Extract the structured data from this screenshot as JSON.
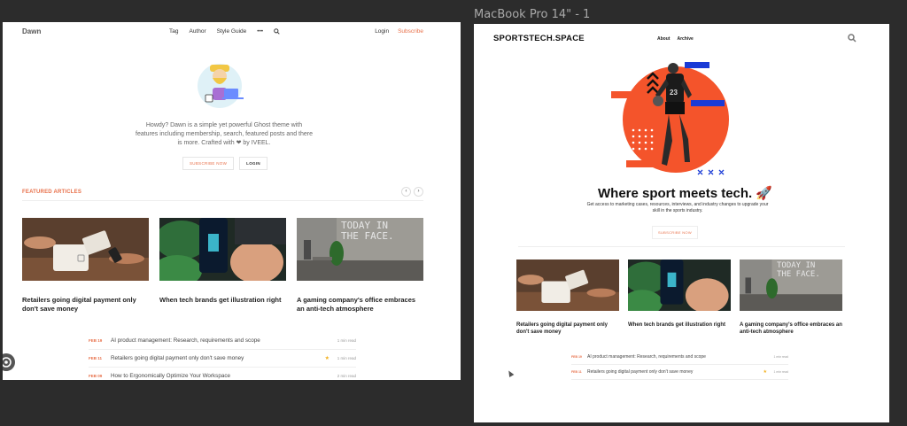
{
  "frame_title": "MacBook Pro 14\" - 1",
  "left": {
    "logo": "Dawn",
    "nav": [
      "Tag",
      "Author",
      "Style Guide",
      "•••"
    ],
    "login": "Login",
    "subscribe": "Subscribe",
    "intro": "Howdy? Dawn is a simple yet powerful Ghost theme with features including membership, search, featured posts and there is more. Crafted with ❤ by IVEEL.",
    "subscribe_now": "SUBSCRIBE NOW",
    "login_btn": "LOGIN",
    "featured": "FEATURED ARTICLES",
    "cards": [
      {
        "title": "Retailers going digital payment only don't save money"
      },
      {
        "title": "When tech brands get illustration right"
      },
      {
        "title": "A gaming company's office embraces an anti-tech atmosphere"
      }
    ],
    "list": [
      {
        "date": "FEB 19",
        "title": "AI product management: Research, requirements and scope",
        "read": "1 min read"
      },
      {
        "date": "FEB 11",
        "title": "Retailers going digital payment only don't save money",
        "read": "1 min read",
        "star": "★"
      },
      {
        "date": "FEB 09",
        "title": "How to Ergonomically Optimize Your Workspace",
        "read": "2 min read"
      }
    ]
  },
  "right": {
    "logo": "SPORTSTECH.SPACE",
    "nav": [
      "About",
      "Archive"
    ],
    "hero_number": "23",
    "headline": "Where sport meets tech. 🚀",
    "sub": "Get access to marketing cases, resources, interviews, and industry changes to upgrade your skill in the sports industry.",
    "subscribe_now": "SUBSCRIBE NOW",
    "cards": [
      {
        "title": "Retailers going digital payment only don't save money"
      },
      {
        "title": "When tech brands get illustration right"
      },
      {
        "title": "A gaming company's office embraces an anti-tech atmosphere"
      }
    ],
    "list": [
      {
        "date": "FEB 19",
        "title": "AI product management: Research, requirements and scope",
        "read": "1 min read"
      },
      {
        "date": "FEB 11",
        "title": "Retailers going digital payment only don't save money",
        "read": "1 min read",
        "star": "★"
      }
    ]
  },
  "image_text": {
    "wall": "TODAY IN THE FACE."
  },
  "colors": {
    "accent": "#e8704a",
    "hero_orange": "#f4542b",
    "hero_blue": "#1a3bd6",
    "bg": "#2c2c2c"
  }
}
